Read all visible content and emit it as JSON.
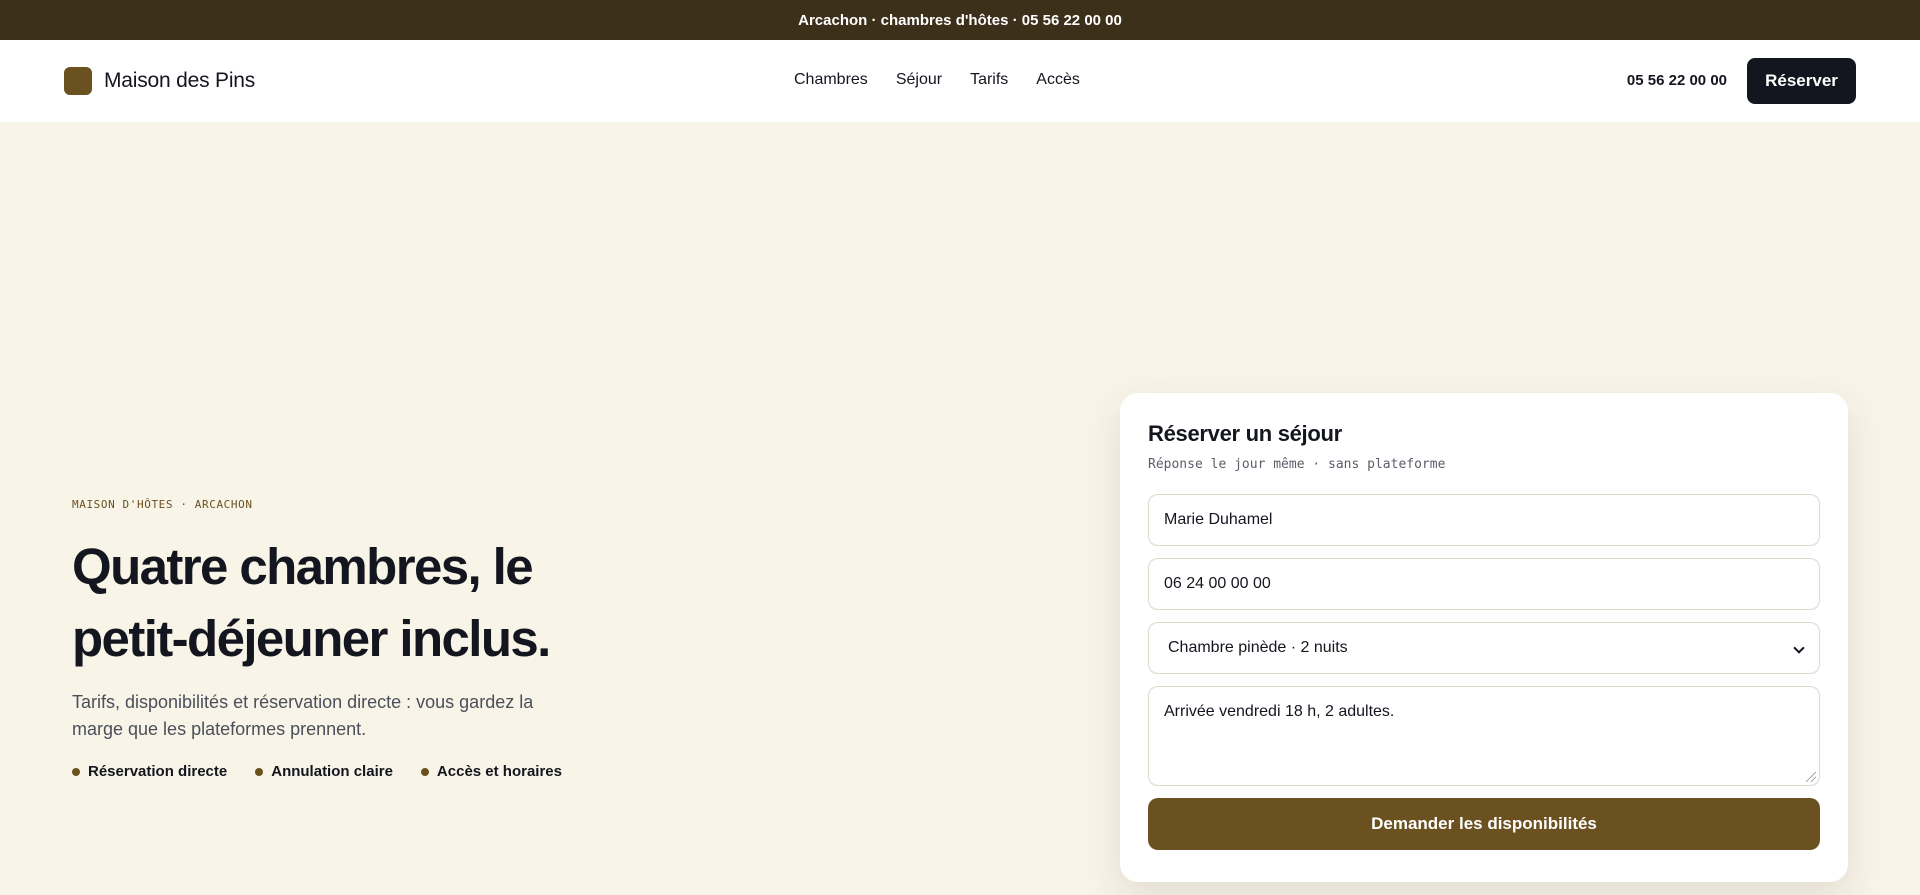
{
  "topbar": {
    "text": "Arcachon · chambres d'hôtes · 05 56 22 00 00"
  },
  "header": {
    "brand": "Maison des Pins",
    "nav": [
      "Chambres",
      "Séjour",
      "Tarifs",
      "Accès"
    ],
    "phone": "05 56 22 00 00",
    "reserve_label": "Réserver"
  },
  "hero": {
    "eyebrow": "MAISON D'HÔTES · ARCACHON",
    "title": "Quatre chambres, le petit-déjeuner inclus.",
    "subtitle": "Tarifs, disponibilités et réservation directe : vous gardez la marge que les plateformes prennent.",
    "features": [
      "Réservation directe",
      "Annulation claire",
      "Accès et horaires"
    ]
  },
  "form": {
    "title": "Réserver un séjour",
    "subtitle": "Réponse le jour même · sans plateforme",
    "name_value": "Marie Duhamel",
    "phone_value": "06 24 00 00 00",
    "room_selected": "Chambre pinède · 2 nuits",
    "message_value": "Arrivée vendredi 18 h, 2 adultes.",
    "submit_label": "Demander les disponibilités"
  },
  "colors": {
    "topbar_bg": "#3d301a",
    "accent": "#6b5020",
    "page_bg": "#f8f4e8",
    "dark_button": "#14161f"
  },
  "icons": {
    "brand_mark": "brand-logo-square",
    "select_arrow": "chevron-down-icon",
    "feature_bullet": "dot"
  }
}
